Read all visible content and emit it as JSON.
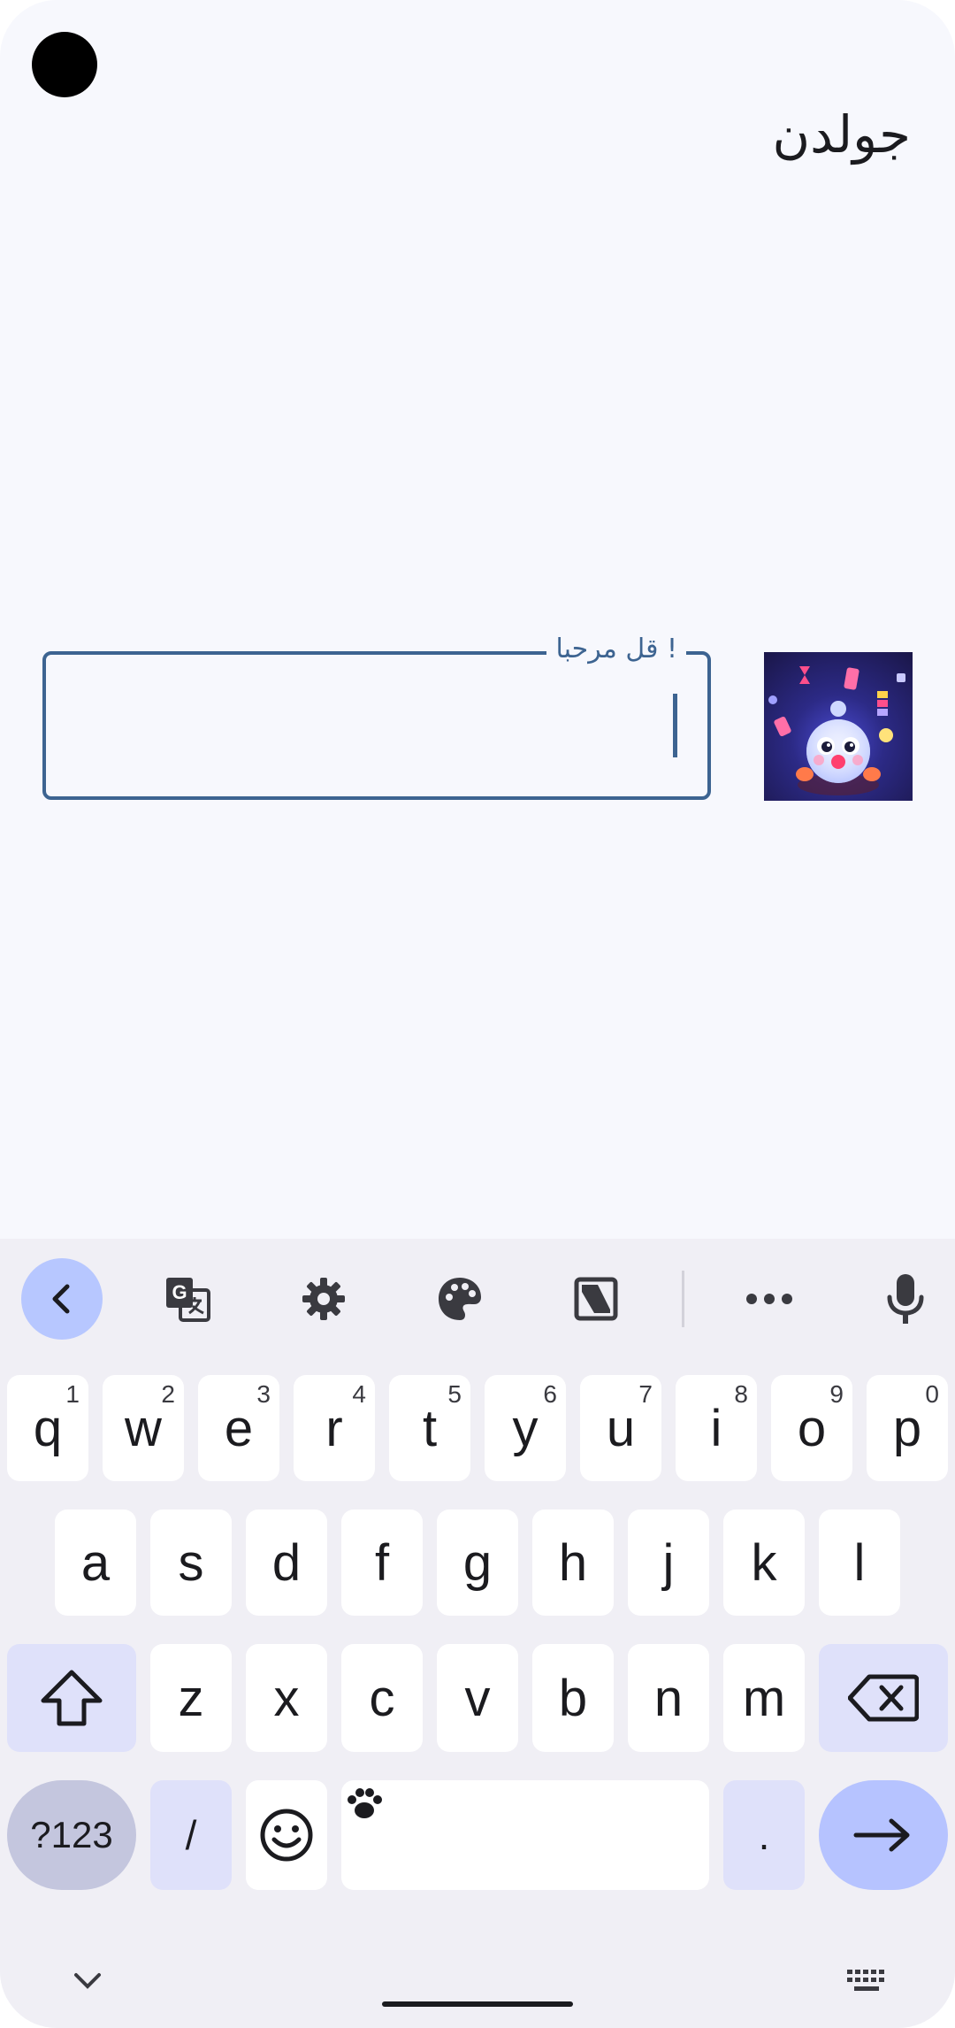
{
  "app": {
    "title": "جولدن"
  },
  "input": {
    "label": "! قل مرحبا",
    "value": ""
  },
  "avatar": {
    "description": "character-image"
  },
  "keyboard": {
    "toolbar": [
      {
        "name": "back-chevron-icon"
      },
      {
        "name": "translate-icon"
      },
      {
        "name": "settings-gear-icon"
      },
      {
        "name": "palette-icon"
      },
      {
        "name": "floating-keyboard-icon"
      },
      {
        "name": "more-dots-icon"
      },
      {
        "name": "microphone-icon"
      }
    ],
    "row1": [
      {
        "label": "q",
        "hint": "1"
      },
      {
        "label": "w",
        "hint": "2"
      },
      {
        "label": "e",
        "hint": "3"
      },
      {
        "label": "r",
        "hint": "4"
      },
      {
        "label": "t",
        "hint": "5"
      },
      {
        "label": "y",
        "hint": "6"
      },
      {
        "label": "u",
        "hint": "7"
      },
      {
        "label": "i",
        "hint": "8"
      },
      {
        "label": "o",
        "hint": "9"
      },
      {
        "label": "p",
        "hint": "0"
      }
    ],
    "row2": [
      "a",
      "s",
      "d",
      "f",
      "g",
      "h",
      "j",
      "k",
      "l"
    ],
    "row3": [
      "z",
      "x",
      "c",
      "v",
      "b",
      "n",
      "m"
    ],
    "row4": {
      "symbols": "?123",
      "slash": "/",
      "period": "."
    }
  },
  "colors": {
    "accent": "#3d6491",
    "keyboard_bg": "#f0eff5",
    "enter": "#b6c3ff",
    "mod": "#dfe1fa"
  }
}
